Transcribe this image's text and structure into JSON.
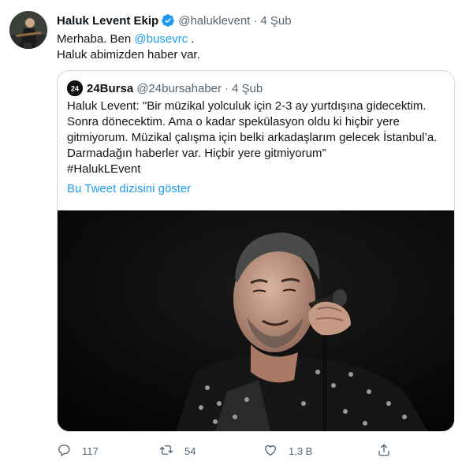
{
  "tweet": {
    "author_name": "Haluk Levent Ekip",
    "author_handle": "@haluklevent",
    "separator": "·",
    "date": "4 Şub",
    "text_line1_prefix": "Merhaba. Ben ",
    "mention": "@busevrc",
    "text_line1_suffix": " .",
    "text_line2": "Haluk abimizden haber var."
  },
  "quoted": {
    "name": "24Bursa",
    "handle": "@24bursahaber",
    "separator": "·",
    "date": "4 Şub",
    "lines": [
      "Haluk Levent: \"Bir müzikal yolculuk için 2-3 ay yurtdışına gidecektim.",
      "Sonra dönecektim. Ama o kadar spekülasyon oldu ki hiçbir yere",
      "gitmiyorum. Müzikal çalışma için belki arkadaşlarım gelecek İstanbul’a.",
      "Darmadağın haberler var. Hiçbir yere gitmiyorum”",
      "#HalukLEvent"
    ],
    "thread_link": "Bu Tweet dizisini göster"
  },
  "actions": {
    "reply_count": "117",
    "retweet_count": "54",
    "like_count": "1,3 B"
  },
  "colors": {
    "text": "#0f1419",
    "secondary": "#536471",
    "accent": "#1d9bf0",
    "border": "#cfd9de"
  },
  "icons": {
    "verified": "verified-badge-icon",
    "reply": "reply-icon",
    "retweet": "retweet-icon",
    "like": "heart-icon",
    "share": "share-icon"
  }
}
